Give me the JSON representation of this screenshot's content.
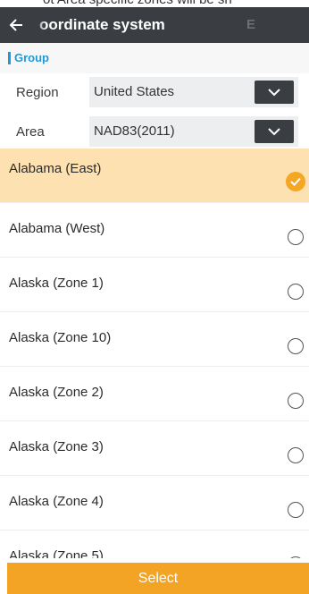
{
  "top_hint": "ot Area specific zones will be sh",
  "toolbar": {
    "title": "oordinate system",
    "right_label": "E"
  },
  "group": {
    "label": "Group"
  },
  "region": {
    "label": "Region",
    "value": "United States"
  },
  "area": {
    "label": "Area",
    "value": "NAD83(2011)"
  },
  "zones": [
    {
      "label": "Alabama (East)",
      "selected": true
    },
    {
      "label": "Alabama (West)",
      "selected": false
    },
    {
      "label": "Alaska (Zone 1)",
      "selected": false
    },
    {
      "label": "Alaska (Zone 10)",
      "selected": false
    },
    {
      "label": "Alaska (Zone 2)",
      "selected": false
    },
    {
      "label": "Alaska (Zone 3)",
      "selected": false
    },
    {
      "label": "Alaska (Zone 4)",
      "selected": false
    },
    {
      "label": "Alaska (Zone 5)",
      "selected": false
    }
  ],
  "footer": {
    "select_label": "Select"
  },
  "colors": {
    "toolbar": "#3a3d42",
    "accent_blue": "#1e9bd7",
    "selected_row": "#fde1b0",
    "accent_orange": "#f5a623"
  },
  "icons": {
    "back": "arrow-left-icon",
    "dropdown": "chevron-down-icon",
    "checked": "check-circle-icon",
    "unchecked": "radio-empty-icon"
  }
}
